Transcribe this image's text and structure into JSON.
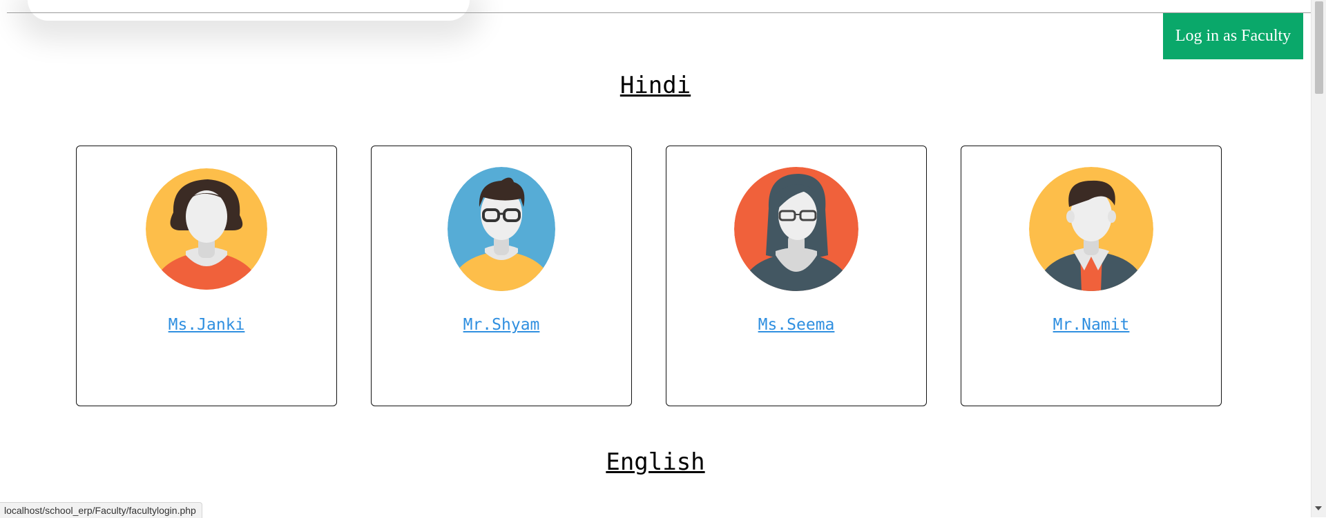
{
  "header": {
    "login_label": "Log in as Faculty"
  },
  "sections": [
    {
      "title": "Hindi",
      "teachers": [
        {
          "name": "Ms.Janki",
          "avatar": "female-avatar-orange-bg-icon"
        },
        {
          "name": "Mr.Shyam",
          "avatar": "male-glasses-avatar-blue-bg-icon"
        },
        {
          "name": "Ms.Seema",
          "avatar": "female-glasses-avatar-red-bg-icon"
        },
        {
          "name": "Mr.Namit",
          "avatar": "male-jacket-avatar-yellow-bg-icon"
        }
      ]
    },
    {
      "title": "English"
    }
  ],
  "status_bar": {
    "url": "localhost/school_erp/Faculty/facultylogin.php"
  },
  "colors": {
    "login_button": "#0aa86a",
    "link": "#2f8fe0",
    "avatar_yellow": "#fdbe4a",
    "avatar_blue": "#56acd6",
    "avatar_red": "#f0613b",
    "avatar_dark": "#435762"
  }
}
